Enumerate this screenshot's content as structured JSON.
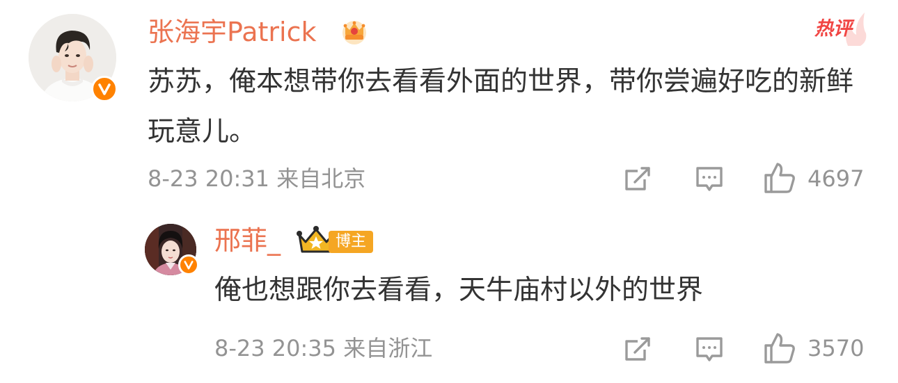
{
  "comment": {
    "username": "张海宇Patrick",
    "text": "苏苏，俺本想带你去看看外面的世界，带你尝遍好吃的新鲜玩意儿。",
    "time": "8-23 20:31",
    "location": "来自北京",
    "likes": "4697",
    "hot_label": "热评",
    "badge_icon": "crown-vip-icon",
    "verified_icon": "orange-v-verified-icon"
  },
  "reply": {
    "username": "邢菲_",
    "host_label": "博主",
    "text": "俺也想跟你去看看，天牛庙村以外的世界",
    "time": "8-23 20:35",
    "location": "来自浙江",
    "likes": "3570",
    "badge_icon": "gold-king-crown-icon",
    "verified_icon": "orange-v-verified-icon"
  },
  "colors": {
    "username": "#eb7350",
    "text": "#333333",
    "meta": "#939393",
    "verified": "#ff8200",
    "hot": "#f14543",
    "host_badge": "#f5a623"
  }
}
